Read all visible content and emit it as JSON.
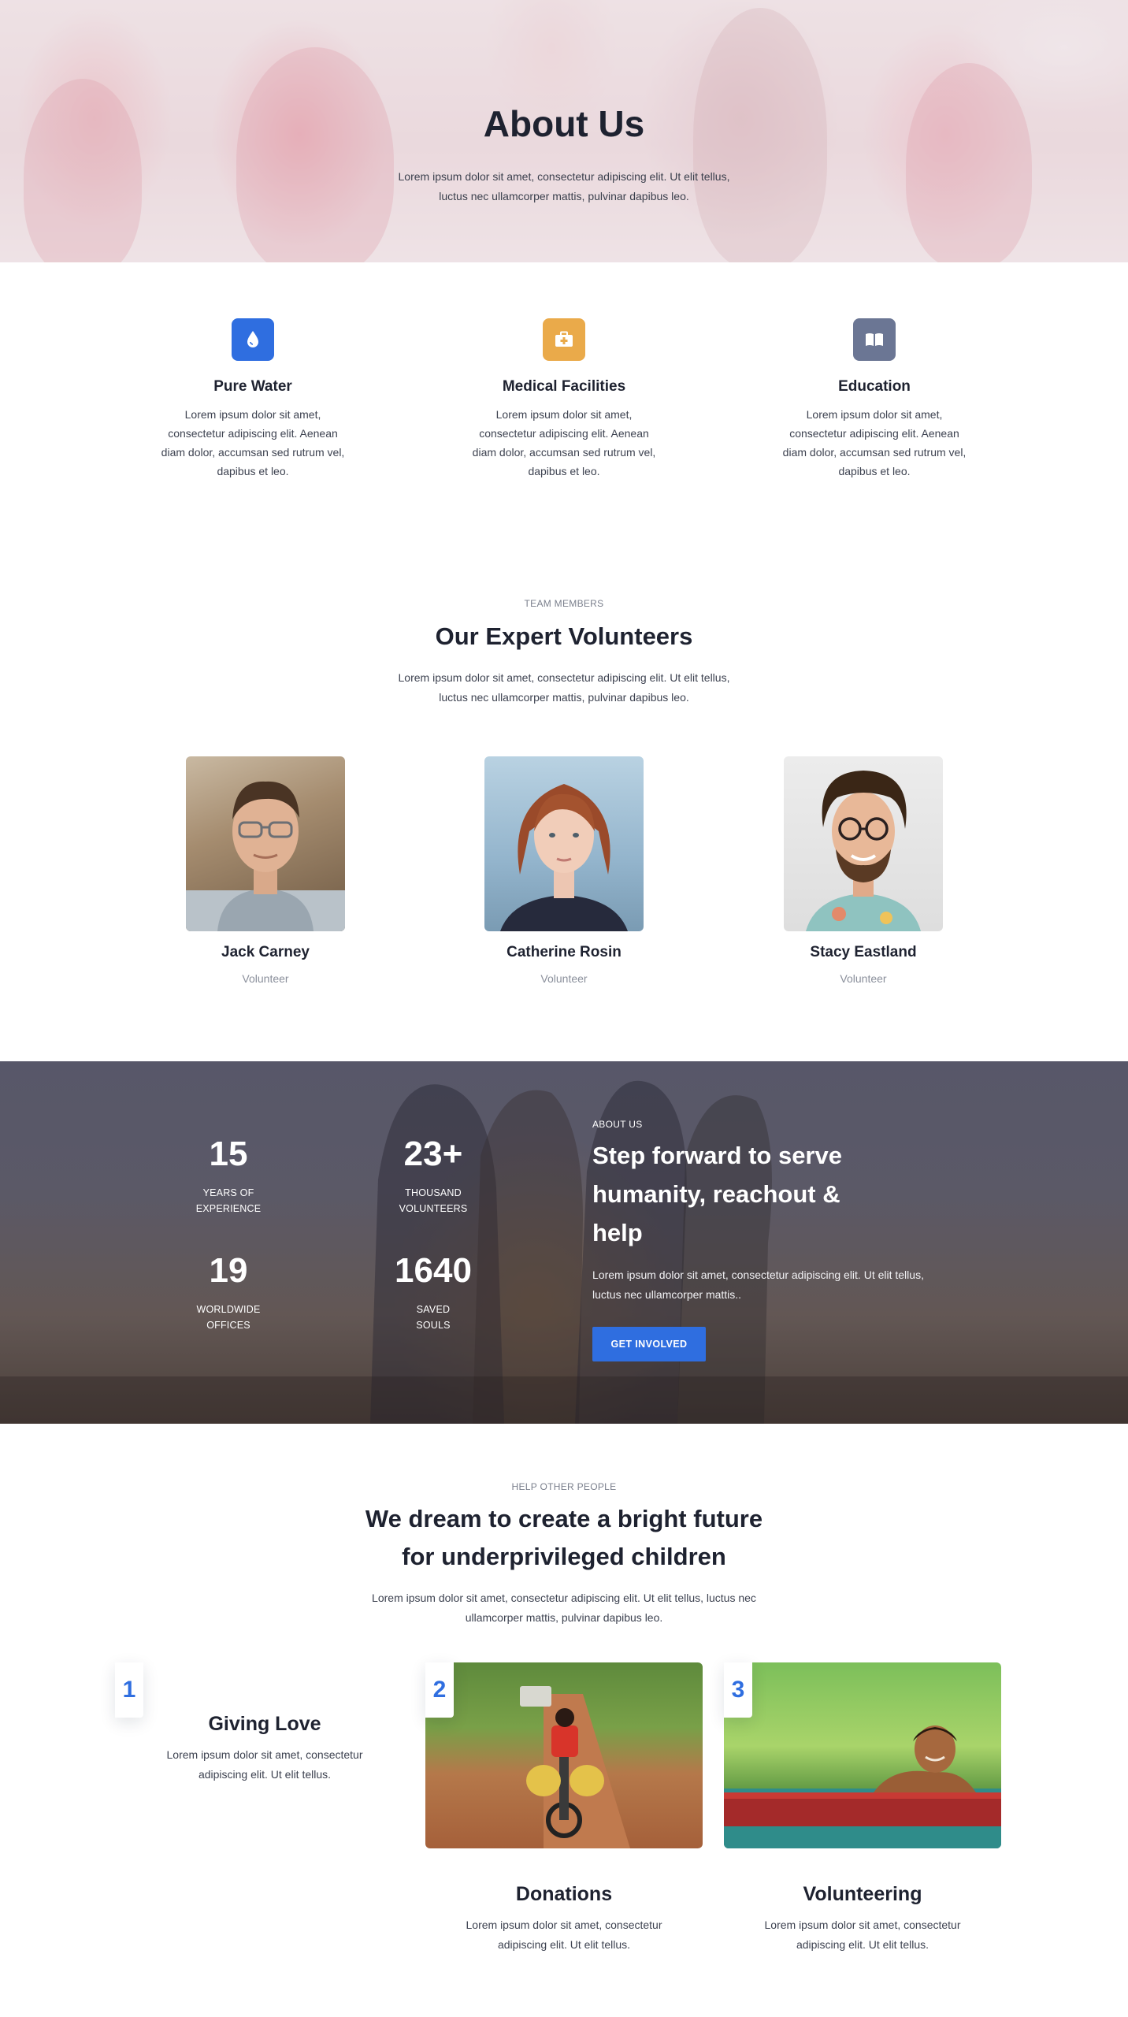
{
  "hero": {
    "title": "About Us",
    "text": "Lorem ipsum dolor sit amet, consectetur adipiscing elit. Ut elit tellus, luctus nec ullamcorper mattis, pulvinar dapibus leo."
  },
  "features": [
    {
      "icon": "water-drop-icon",
      "color": "#2f6ee0",
      "title": "Pure Water",
      "text": "Lorem ipsum dolor sit amet, consectetur adipiscing elit. Aenean diam dolor, accumsan sed rutrum vel, dapibus et leo."
    },
    {
      "icon": "medical-kit-icon",
      "color": "#eaaa4a",
      "title": "Medical Facilities",
      "text": "Lorem ipsum dolor sit amet, consectetur adipiscing elit. Aenean diam dolor, accumsan sed rutrum vel, dapibus et leo."
    },
    {
      "icon": "open-book-icon",
      "color": "#6b7694",
      "title": "Education",
      "text": "Lorem ipsum dolor sit amet, consectetur adipiscing elit. Aenean diam dolor, accumsan sed rutrum vel, dapibus et leo."
    }
  ],
  "team": {
    "eyebrow": "TEAM MEMBERS",
    "title": "Our Expert Volunteers",
    "text": "Lorem ipsum dolor sit amet, consectetur adipiscing elit. Ut elit tellus, luctus nec ullamcorper mattis, pulvinar dapibus leo.",
    "members": [
      {
        "name": "Jack Carney",
        "role": "Volunteer"
      },
      {
        "name": "Catherine Rosin",
        "role": "Volunteer"
      },
      {
        "name": "Stacy Eastland",
        "role": "Volunteer"
      }
    ]
  },
  "stats": {
    "items": [
      {
        "number": "15",
        "label_line1": "YEARS OF",
        "label_line2": "EXPERIENCE"
      },
      {
        "number": "23+",
        "label_line1": "THOUSAND",
        "label_line2": "VOLUNTEERS"
      },
      {
        "number": "19",
        "label_line1": "WORLDWIDE",
        "label_line2": "OFFICES"
      },
      {
        "number": "1640",
        "label_line1": "SAVED",
        "label_line2": "SOULS"
      }
    ],
    "eyebrow": "ABOUT US",
    "title": "Step forward to serve humanity, reachout & help",
    "text": "Lorem ipsum dolor sit amet, consectetur adipiscing elit. Ut elit tellus, luctus nec ullamcorper mattis..",
    "button_label": "GET INVOLVED",
    "button_color": "#2f6ee0"
  },
  "future": {
    "eyebrow": "HELP OTHER PEOPLE",
    "title_line1": "We dream to create a bright future",
    "title_line2": "for underprivileged children",
    "text": "Lorem ipsum dolor sit amet, consectetur adipiscing elit. Ut elit tellus, luctus nec ullamcorper mattis, pulvinar dapibus leo.",
    "steps": [
      {
        "number": "1",
        "title": "Giving Love",
        "text": "Lorem ipsum dolor sit amet, consectetur adipiscing elit. Ut elit tellus."
      },
      {
        "number": "2",
        "title": "Donations",
        "text": "Lorem ipsum dolor sit amet, consectetur adipiscing elit. Ut elit tellus."
      },
      {
        "number": "3",
        "title": "Volunteering",
        "text": "Lorem ipsum dolor sit amet, consectetur adipiscing elit. Ut elit tellus."
      }
    ]
  }
}
